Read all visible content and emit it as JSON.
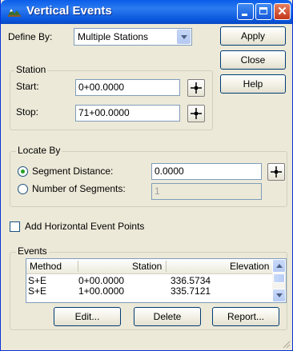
{
  "window": {
    "title": "Vertical Events"
  },
  "icons": {
    "app": "vertical-events-app-icon",
    "pick": "crosshair-pick-icon"
  },
  "define_by": {
    "label": "Define By:",
    "value": "Multiple Stations"
  },
  "actions": {
    "apply": "Apply",
    "close": "Close",
    "help": "Help"
  },
  "station": {
    "title": "Station",
    "start_label": "Start:",
    "start_value": "0+00.0000",
    "stop_label": "Stop:",
    "stop_value": "71+00.0000"
  },
  "locate_by": {
    "title": "Locate By",
    "segment_distance_label": "Segment Distance:",
    "segment_distance_value": "0.0000",
    "segment_distance_selected": true,
    "num_segments_label": "Number of Segments:",
    "num_segments_value": "1",
    "num_segments_selected": false
  },
  "add_horizontal": {
    "label": "Add Horizontal Event Points",
    "checked": false
  },
  "events": {
    "title": "Events",
    "columns": [
      "Method",
      "Station",
      "Elevation"
    ],
    "rows": [
      {
        "method": "S+E",
        "station": "0+00.0000",
        "elevation": "336.5734"
      },
      {
        "method": "S+E",
        "station": "1+00.0000",
        "elevation": "335.7121"
      }
    ],
    "edit": "Edit...",
    "delete": "Delete",
    "report": "Report..."
  },
  "colors": {
    "title_bar": "#0a5de9",
    "dialog": "#ece9d8",
    "accent_green": "#21a121"
  }
}
